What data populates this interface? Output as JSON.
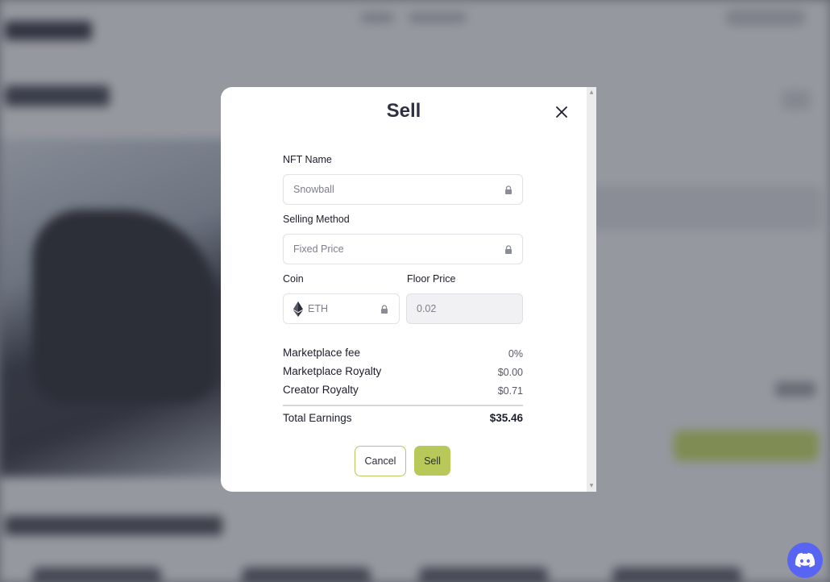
{
  "modal": {
    "title": "Sell",
    "fields": {
      "nft_name": {
        "label": "NFT Name",
        "value": "Snowball",
        "locked": true
      },
      "selling_method": {
        "label": "Selling Method",
        "value": "Fixed Price",
        "locked": true
      },
      "coin": {
        "label": "Coin",
        "value": "ETH",
        "icon": "ethereum-icon",
        "locked": true
      },
      "floor_price": {
        "label": "Floor Price",
        "value": "0.02",
        "disabled": true
      }
    },
    "summary": {
      "marketplace_fee": {
        "label": "Marketplace fee",
        "value": "0%"
      },
      "marketplace_royalty": {
        "label": "Marketplace Royalty",
        "value": "$0.00"
      },
      "creator_royalty": {
        "label": "Creator Royalty",
        "value": "$0.71"
      },
      "total_earnings": {
        "label": "Total Earnings",
        "value": "$35.46"
      }
    },
    "actions": {
      "cancel_label": "Cancel",
      "sell_label": "Sell"
    }
  },
  "colors": {
    "accent": "#b8c95a",
    "accent_border": "#b6c95e",
    "title_text": "#2d3142",
    "discord": "#5865f2"
  },
  "icons": [
    "close-icon",
    "lock-icon",
    "ethereum-icon",
    "discord-icon"
  ]
}
